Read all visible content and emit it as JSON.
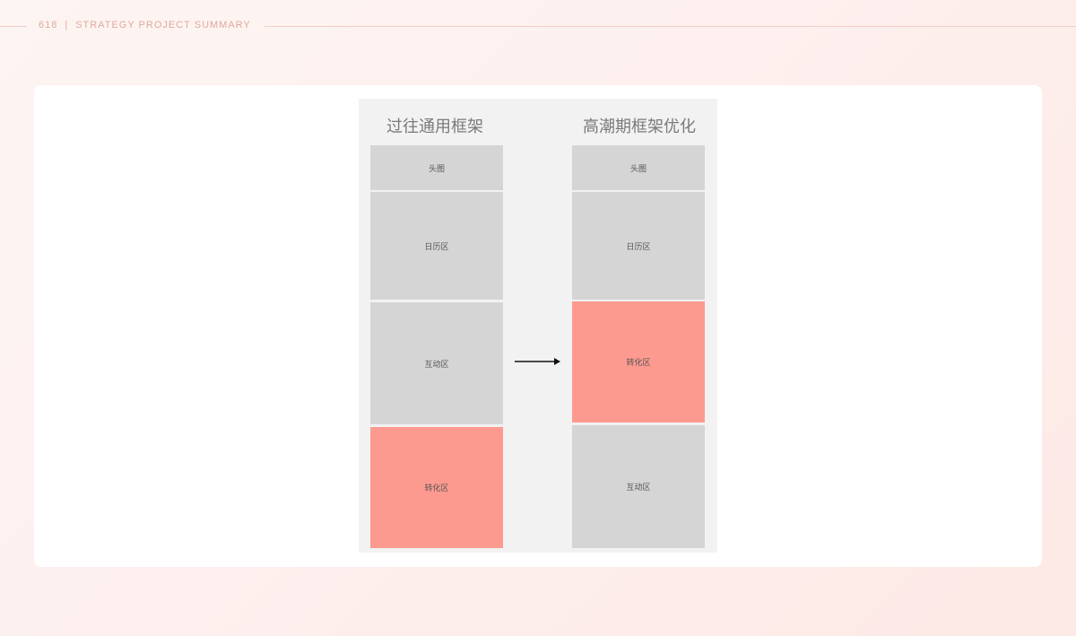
{
  "header": {
    "page_number": "618",
    "separator": "|",
    "section_title": "STRATEGY PROJECT SUMMARY"
  },
  "colors": {
    "block_default": "#d5d5d5",
    "block_highlight": "#fd9a90",
    "panel_background": "#f2f2f2",
    "accent_text": "#dfa99a"
  },
  "diagram": {
    "left_column": {
      "title": "过往通用框架",
      "blocks": [
        {
          "label": "头图",
          "highlight": false
        },
        {
          "label": "日历区",
          "highlight": false
        },
        {
          "label": "互动区",
          "highlight": false
        },
        {
          "label": "转化区",
          "highlight": true
        }
      ]
    },
    "right_column": {
      "title": "高潮期框架优化",
      "blocks": [
        {
          "label": "头图",
          "highlight": false
        },
        {
          "label": "日历区",
          "highlight": false
        },
        {
          "label": "转化区",
          "highlight": true
        },
        {
          "label": "互动区",
          "highlight": false
        }
      ]
    },
    "arrow_icon": "right-arrow-icon"
  }
}
